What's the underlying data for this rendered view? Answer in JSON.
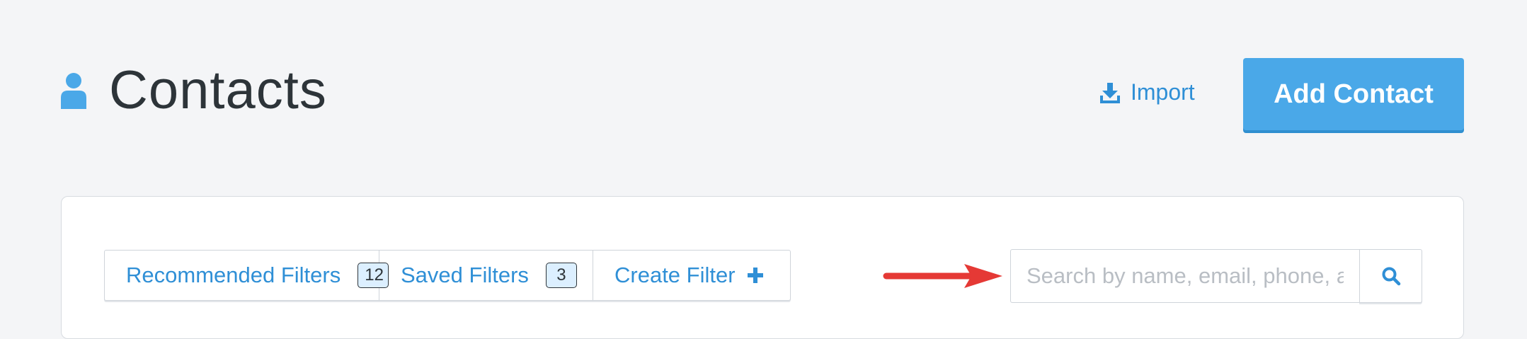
{
  "header": {
    "title": "Contacts",
    "import_label": "Import",
    "add_contact_label": "Add Contact"
  },
  "filters": {
    "recommended": {
      "label": "Recommended Filters",
      "count": "12"
    },
    "saved": {
      "label": "Saved Filters",
      "count": "3"
    },
    "create": {
      "label": "Create Filter"
    }
  },
  "search": {
    "placeholder": "Search by name, email, phone, a",
    "value": ""
  },
  "colors": {
    "accent": "#4aa8e8",
    "link": "#2f8fd6",
    "annotation_arrow": "#e53935",
    "background": "#f4f5f7"
  },
  "icons": {
    "title_icon": "person-icon",
    "import_icon": "download-icon",
    "create_icon": "plus-icon",
    "search_icon": "search-icon"
  }
}
